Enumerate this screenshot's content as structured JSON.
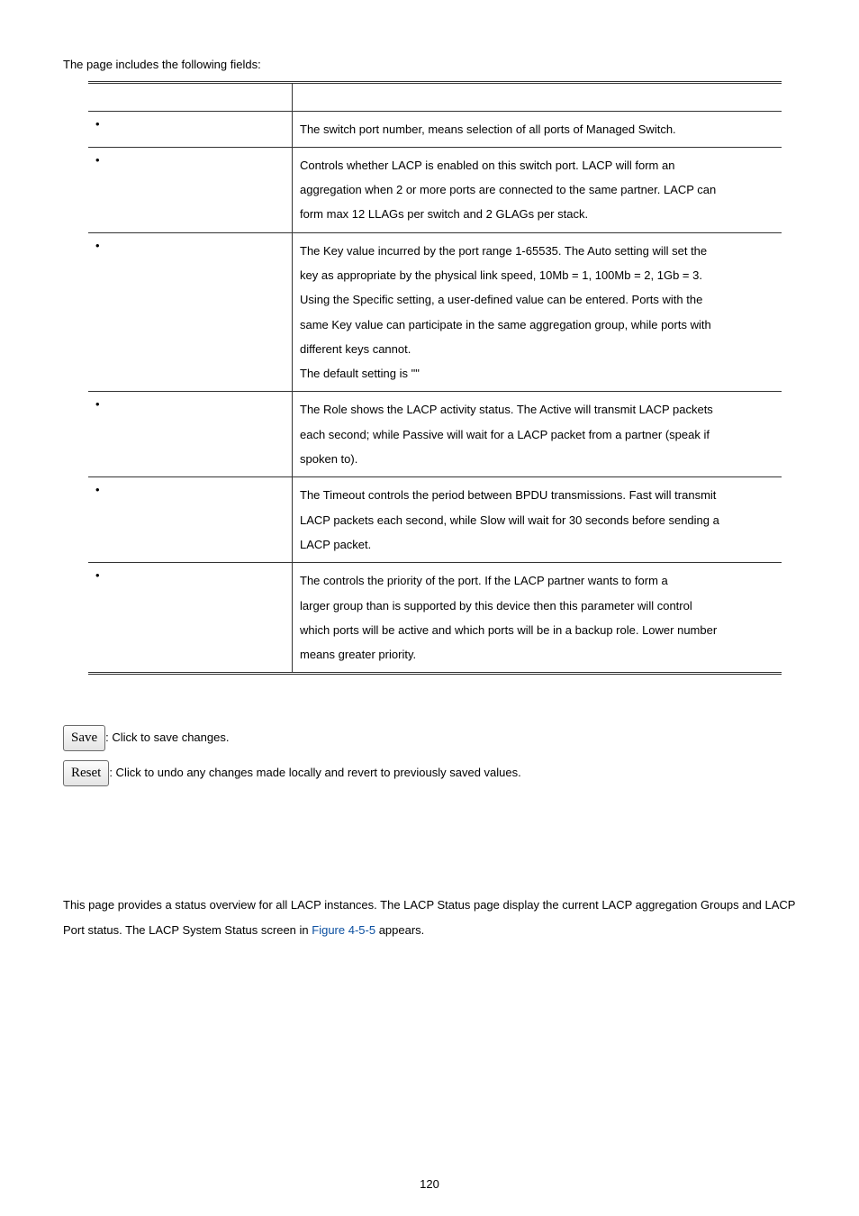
{
  "intro": "The page includes the following fields:",
  "table": {
    "header_object": "",
    "header_desc": "",
    "rows": [
      {
        "object": "",
        "desc_lines": [
          {
            "text_before": "The switch port number, ",
            "bold": "",
            "text_after": " means selection of all ports of Managed Switch."
          }
        ]
      },
      {
        "object": "",
        "desc_lines": [
          {
            "text_before": "Controls whether LACP is enabled on this switch port. LACP will form an",
            "bold": "",
            "text_after": ""
          },
          {
            "text_before": "aggregation when 2 or more ports are connected to the same partner. LACP can",
            "bold": "",
            "text_after": ""
          },
          {
            "text_before": "form max 12 LLAGs per switch and 2 GLAGs per stack.",
            "bold": "",
            "text_after": ""
          }
        ]
      },
      {
        "object": "",
        "desc_lines": [
          {
            "text_before": "The Key value incurred by the port range 1-65535. The Auto setting will set the",
            "bold": "",
            "text_after": ""
          },
          {
            "text_before": "key as appropriate by the physical link speed, 10Mb = 1, 100Mb = 2, 1Gb = 3.",
            "bold": "",
            "text_after": ""
          },
          {
            "text_before": "Using the Specific setting, a user-defined value can be entered. Ports with the",
            "bold": "",
            "text_after": ""
          },
          {
            "text_before": "same Key value can participate in the same aggregation group, while ports with",
            "bold": "",
            "text_after": ""
          },
          {
            "text_before": "different keys cannot.",
            "bold": "",
            "text_after": ""
          },
          {
            "text_before": "The default setting is \"",
            "bold": "",
            "text_after": "\""
          }
        ]
      },
      {
        "object": "",
        "desc_lines": [
          {
            "text_before": "The Role shows the LACP activity status. The Active will transmit LACP packets",
            "bold": "",
            "text_after": ""
          },
          {
            "text_before": "each second; while Passive will wait for a LACP packet from a partner (speak if",
            "bold": "",
            "text_after": ""
          },
          {
            "text_before": "spoken to).",
            "bold": "",
            "text_after": ""
          }
        ]
      },
      {
        "object": "",
        "desc_lines": [
          {
            "text_before": "The Timeout controls the period between BPDU transmissions. Fast will transmit",
            "bold": "",
            "text_after": ""
          },
          {
            "text_before": "LACP packets each second, while Slow will wait for 30 seconds before sending a",
            "bold": "",
            "text_after": ""
          },
          {
            "text_before": "LACP packet.",
            "bold": "",
            "text_after": ""
          }
        ]
      },
      {
        "object": "",
        "desc_lines": [
          {
            "text_before": "The ",
            "bold": "",
            "text_after": " controls the priority of the port. If the LACP partner wants to form a"
          },
          {
            "text_before": "larger group than is supported by this device then this parameter will control",
            "bold": "",
            "text_after": ""
          },
          {
            "text_before": "which ports will be active and which ports will be in a backup role. Lower number",
            "bold": "",
            "text_after": ""
          },
          {
            "text_before": "means greater priority.",
            "bold": "",
            "text_after": ""
          }
        ]
      }
    ]
  },
  "buttons": {
    "save_label": "Save",
    "save_desc": ": Click to save changes.",
    "reset_label": "Reset",
    "reset_desc": ": Click to undo any changes made locally and revert to previously saved values."
  },
  "section": {
    "para_before": "This page provides a status overview for all LACP instances. The LACP Status page display the current LACP aggregation Groups and LACP Port status. The LACP System Status screen in ",
    "link": "Figure 4-5-5",
    "para_after": " appears."
  },
  "pagenum": "120"
}
